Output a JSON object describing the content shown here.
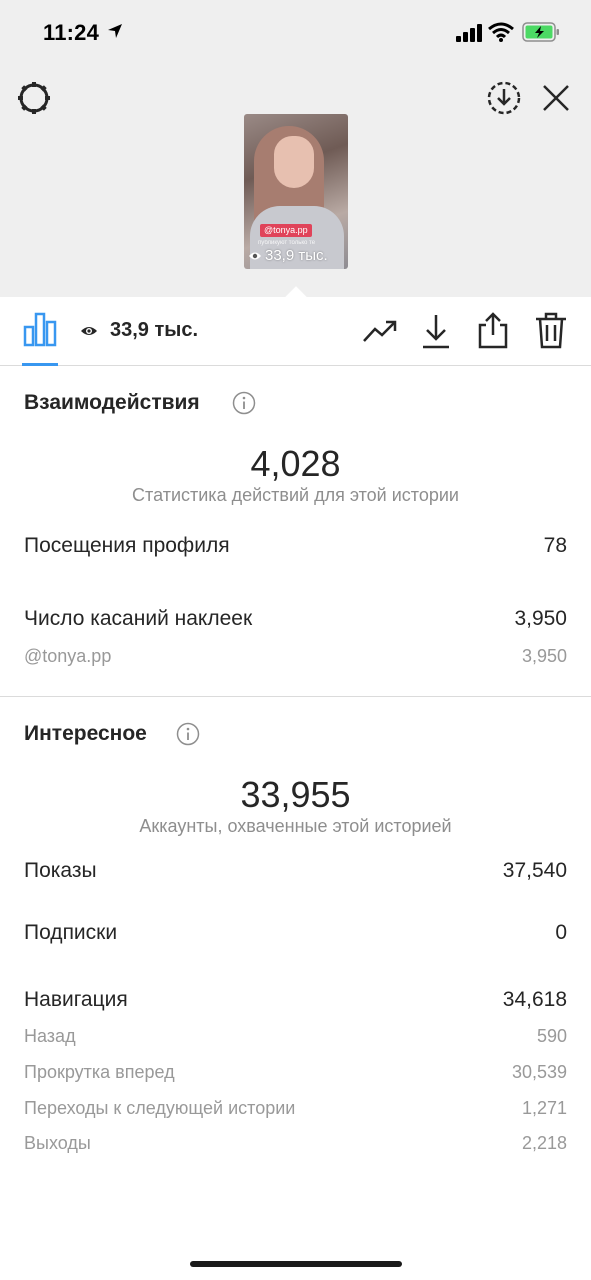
{
  "status_bar": {
    "time": "11:24"
  },
  "preview": {
    "tag": "@tonya.pp",
    "caption": "публикуют только те",
    "views": "33,9 тыс."
  },
  "toolbar": {
    "views": "33,9 тыс."
  },
  "interactions": {
    "title": "Взаимодействия",
    "total": "4,028",
    "total_caption": "Статистика действий для этой истории",
    "rows": [
      {
        "label": "Посещения профиля",
        "value": "78"
      },
      {
        "label": "Число касаний наклеек",
        "value": "3,950"
      }
    ],
    "sub_rows": [
      {
        "label": "@tonya.pp",
        "value": "3,950"
      }
    ]
  },
  "discovery": {
    "title": "Интересное",
    "total": "33,955",
    "total_caption": "Аккаунты, охваченные этой историей",
    "rows": [
      {
        "label": "Показы",
        "value": "37,540"
      },
      {
        "label": "Подписки",
        "value": "0"
      },
      {
        "label": "Навигация",
        "value": "34,618"
      }
    ],
    "sub_rows": [
      {
        "label": "Назад",
        "value": "590"
      },
      {
        "label": "Прокрутка вперед",
        "value": "30,539"
      },
      {
        "label": "Переходы к следующей истории",
        "value": "1,271"
      },
      {
        "label": "Выходы",
        "value": "2,218"
      }
    ]
  },
  "icons": {
    "settings": "gear-icon",
    "download_circle": "download-circle-icon",
    "close": "close-icon",
    "chart": "bar-chart-icon",
    "eye": "eye-icon",
    "trend": "trending-up-icon",
    "download": "download-icon",
    "share": "share-icon",
    "trash": "trash-icon",
    "info": "info-icon"
  },
  "colors": {
    "accent": "#3897f0",
    "battery": "#4cd964",
    "tag": "#e0435a"
  }
}
